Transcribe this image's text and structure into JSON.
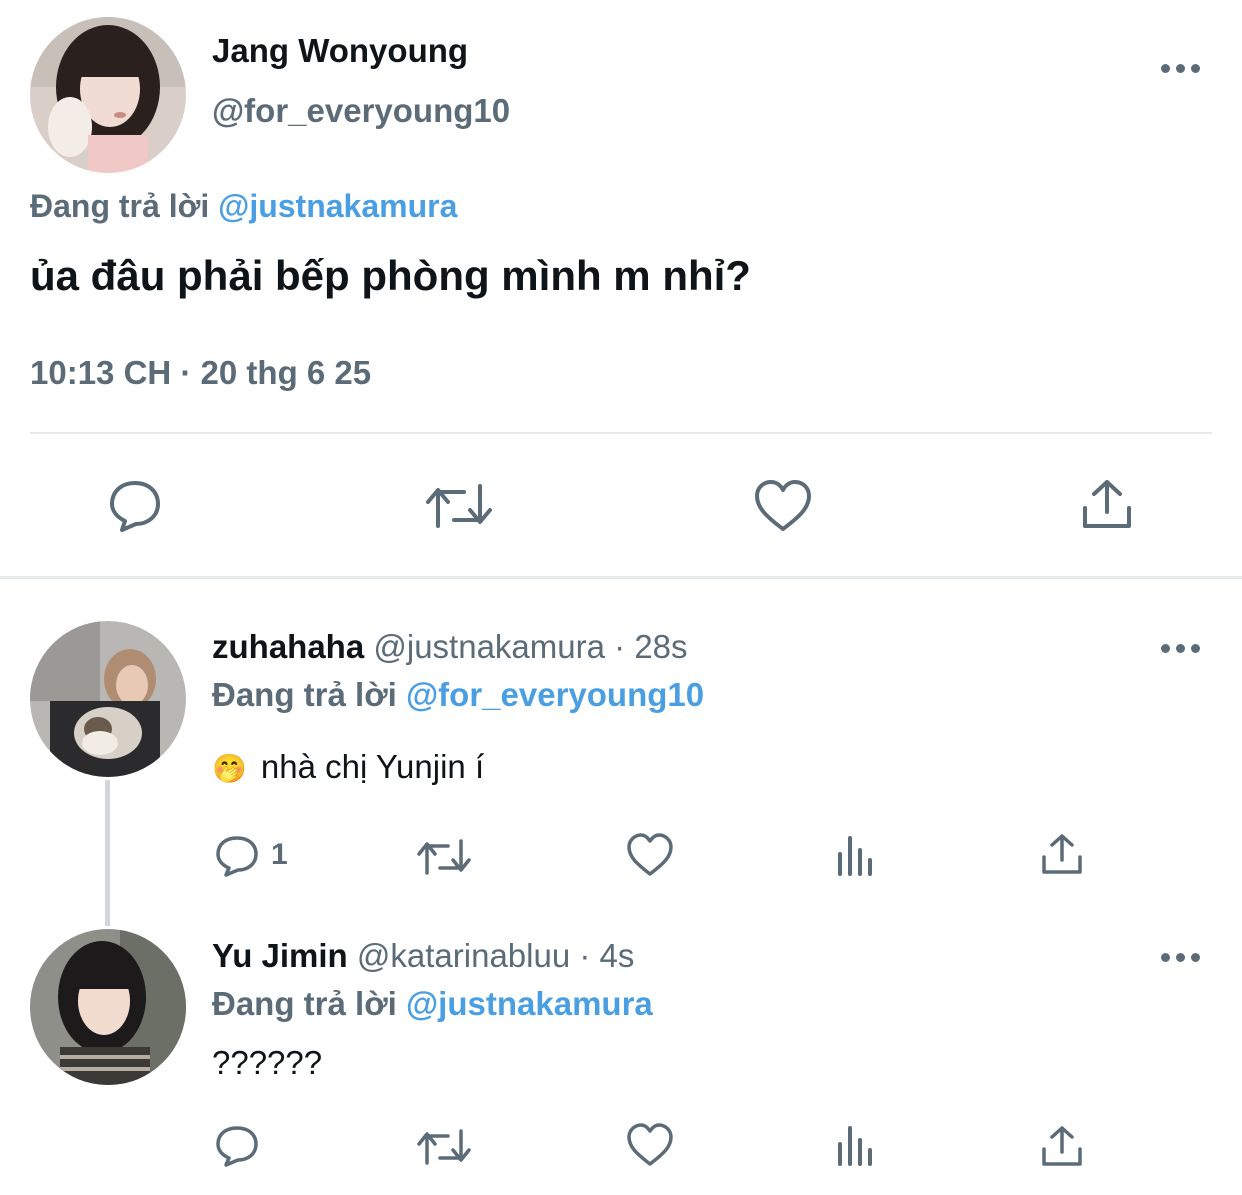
{
  "main_tweet": {
    "display_name": "Jang Wonyoung",
    "handle": "@for_everyoung10",
    "replying_prefix": "Đang trả lời",
    "replying_to": "@justnakamura",
    "text": "ủa đâu phải bếp phòng mình m nhỉ?",
    "timestamp": "10:13 CH · 20 thg 6 25",
    "actions": [
      "reply-icon",
      "retweet-icon",
      "like-icon",
      "share-icon"
    ]
  },
  "replies": [
    {
      "display_name": "zuhahaha",
      "handle": "@justnakamura",
      "time": "· 28s",
      "replying_prefix": "Đang trả lời",
      "replying_to": "@for_everyoung10",
      "emoji": "🤭",
      "text": "nhà chị Yunjin í",
      "reply_count": "1"
    },
    {
      "display_name": "Yu Jimin",
      "handle": "@katarinabluu",
      "time": "· 4s",
      "replying_prefix": "Đang trả lời",
      "replying_to": "@justnakamura",
      "text": "??????",
      "reply_count": ""
    }
  ],
  "colors": {
    "link": "#4a9fe3",
    "icon": "#5b6b78",
    "divider": "#e6e9eb"
  }
}
